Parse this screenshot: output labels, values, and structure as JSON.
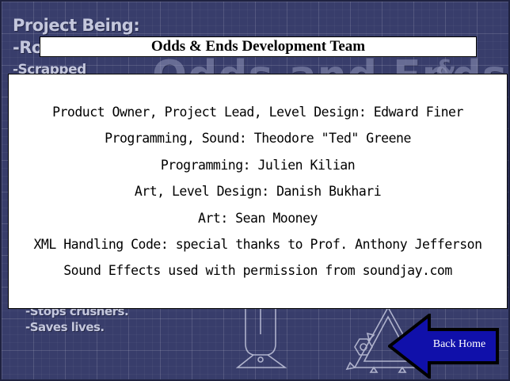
{
  "background": {
    "heading": "Project Being:",
    "line1": "-Ro",
    "line2": "-Scrapped",
    "big_title": "Odds and Ends",
    "amp": "&",
    "line5": "-Stops crushers.",
    "line6": "-Saves lives."
  },
  "title_bar": {
    "text": "Odds & Ends Development Team"
  },
  "credits": [
    "Product Owner, Project Lead, Level Design: Edward Finer",
    "Programming, Sound: Theodore \"Ted\" Greene",
    "Programming: Julien Kilian",
    "Art, Level Design: Danish Bukhari",
    "Art: Sean Mooney",
    "XML Handling Code: special thanks to Prof. Anthony Jefferson",
    "Sound Effects used with permission from soundjay.com"
  ],
  "back_button": {
    "label": "Back Home",
    "icon": "left-arrow-icon",
    "fill_color": "#1010aa",
    "outline_color": "#000000"
  },
  "colors": {
    "background": "#383d6b",
    "panel": "#ffffff",
    "text": "#000000"
  }
}
